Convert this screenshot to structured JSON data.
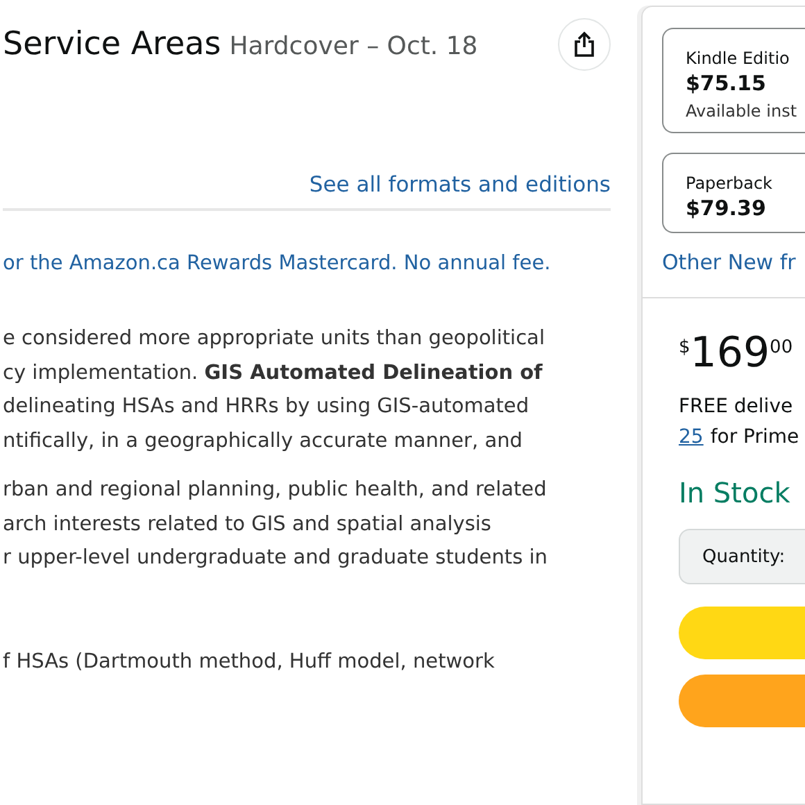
{
  "product": {
    "title": "Service Areas",
    "format_date": "Hardcover – Oct. 18"
  },
  "formats_link": "See all formats and editions",
  "card_offer": "or the Amazon.ca Rewards Mastercard. No annual fee.",
  "description": [
    [
      "e considered more appropriate units than geopolitical",
      "cy implementation. **GIS Automated Delineation of**",
      "delineating HSAs and HRRs by using GIS-automated",
      "ntifically, in a geographically accurate manner, and"
    ],
    [
      "rban and regional planning, public health, and related",
      "arch interests related to GIS and spatial analysis",
      "r upper-level undergraduate and graduate students in"
    ],
    [
      "f HSAs (Dartmouth method, Huff model, network"
    ]
  ],
  "formats": [
    {
      "name": "Kindle Editio",
      "price": "$75.15",
      "note": "Available inst"
    },
    {
      "name": "Paperback",
      "price": "$79.39"
    }
  ],
  "other_sellers": "Other New fr",
  "buy_box": {
    "currency": "$",
    "whole": "169",
    "fraction": "00",
    "delivery": "FREE delive",
    "delivery_date": "25",
    "delivery_rest": "for Prime",
    "availability": "In Stock",
    "quantity_label": "Quantity:",
    "buttons": [
      {
        "color": "#ffd814"
      },
      {
        "color": "#ffa41c"
      }
    ]
  }
}
